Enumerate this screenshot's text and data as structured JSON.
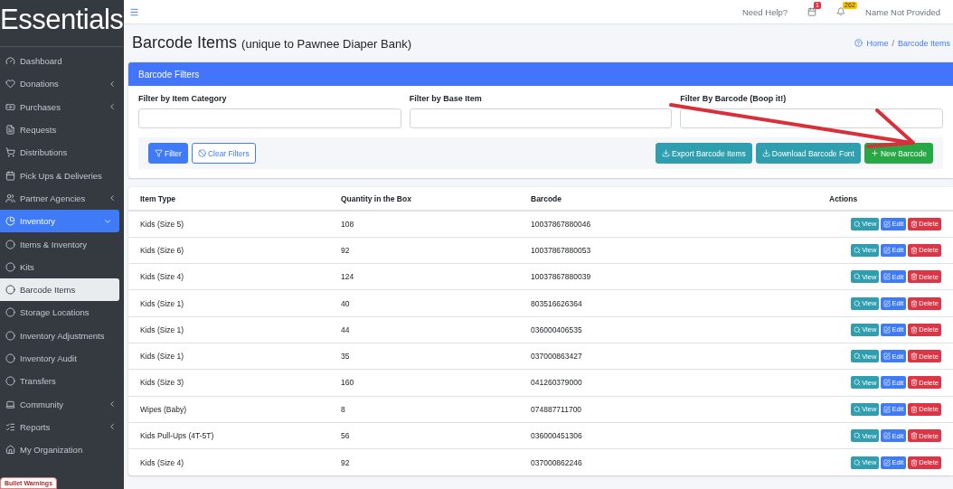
{
  "sidebar": {
    "logo": "Essentials",
    "items": [
      {
        "label": "Dashboard",
        "selected": false
      },
      {
        "label": "Donations",
        "selected": false,
        "expanded": false
      },
      {
        "label": "Purchases",
        "selected": false,
        "expanded": false
      },
      {
        "label": "Requests",
        "selected": false
      },
      {
        "label": "Distributions",
        "selected": false
      },
      {
        "label": "Pick Ups & Deliveries",
        "selected": false
      },
      {
        "label": "Partner Agencies",
        "selected": false,
        "expanded": false
      },
      {
        "label": "Inventory",
        "selected": true,
        "expanded": true,
        "children": [
          {
            "label": "Items & Inventory",
            "selected": false
          },
          {
            "label": "Kits",
            "selected": false
          },
          {
            "label": "Barcode Items",
            "selected": true
          },
          {
            "label": "Storage Locations",
            "selected": false
          },
          {
            "label": "Inventory Adjustments",
            "selected": false
          },
          {
            "label": "Inventory Audit",
            "selected": false
          },
          {
            "label": "Transfers",
            "selected": false
          }
        ]
      },
      {
        "label": "Community",
        "selected": false,
        "expanded": false
      },
      {
        "label": "Reports",
        "selected": false,
        "expanded": false
      },
      {
        "label": "My Organization",
        "selected": false
      }
    ],
    "warning_badge": "Bullet Warnings"
  },
  "navbar": {
    "help": "Need Help?",
    "calendar_badge": "1",
    "notification_badge": "262",
    "user": "Name Not Provided"
  },
  "page": {
    "title": "Barcode Items",
    "subtitle": "(unique to Pawnee Diaper Bank)",
    "breadcrumb": [
      "Home",
      "Barcode Items"
    ],
    "breadcrumb_separator": "/"
  },
  "filters": {
    "title": "Barcode Filters",
    "fields": [
      {
        "label": "Filter by Item Category"
      },
      {
        "label": "Filter by Base Item"
      },
      {
        "label": "Filter By Barcode (Boop it!)"
      }
    ],
    "buttons": [
      "Filter",
      "Clear Filters"
    ],
    "actions": [
      "Export Barcode Items",
      "Download Barcode Font",
      "New Barcode"
    ]
  },
  "table": {
    "columns": [
      "Item Type",
      "Quantity in the Box",
      "Barcode",
      "Actions"
    ],
    "rows": [
      {
        "cells": [
          "Kids (Size 5)",
          "108",
          "10037867880046"
        ],
        "actions": [
          "View",
          "Edit",
          "Delete"
        ]
      },
      {
        "cells": [
          "Kids (Size 6)",
          "92",
          "10037867880053"
        ],
        "actions": [
          "View",
          "Edit",
          "Delete"
        ]
      },
      {
        "cells": [
          "Kids (Size 4)",
          "124",
          "10037867880039"
        ],
        "actions": [
          "View",
          "Edit",
          "Delete"
        ]
      },
      {
        "cells": [
          "Kids (Size 1)",
          "40",
          "803516626364"
        ],
        "actions": [
          "View",
          "Edit",
          "Delete"
        ]
      },
      {
        "cells": [
          "Kids (Size 1)",
          "44",
          "036000406535"
        ],
        "actions": [
          "View",
          "Edit",
          "Delete"
        ]
      },
      {
        "cells": [
          "Kids (Size 1)",
          "35",
          "037000863427"
        ],
        "actions": [
          "View",
          "Edit",
          "Delete"
        ]
      },
      {
        "cells": [
          "Kids (Size 3)",
          "160",
          "041260379000"
        ],
        "actions": [
          "View",
          "Edit",
          "Delete"
        ]
      },
      {
        "cells": [
          "Wipes (Baby)",
          "8",
          "074887711700"
        ],
        "actions": [
          "View",
          "Edit",
          "Delete"
        ]
      },
      {
        "cells": [
          "Kids Pull-Ups (4T-5T)",
          "56",
          "036000451306"
        ],
        "actions": [
          "View",
          "Edit",
          "Delete"
        ]
      },
      {
        "cells": [
          "Kids (Size 4)",
          "92",
          "037000862246"
        ],
        "actions": [
          "View",
          "Edit",
          "Delete"
        ]
      }
    ]
  }
}
